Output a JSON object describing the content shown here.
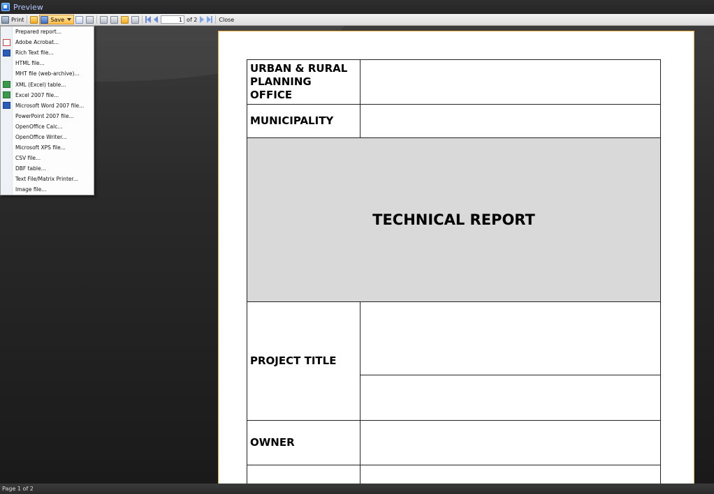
{
  "window": {
    "title": "Preview"
  },
  "toolbar": {
    "print_label": "Print",
    "save_label": "Save",
    "page_value": "1",
    "page_of": "of 2",
    "close_label": "Close"
  },
  "save_menu": {
    "items": [
      {
        "label": "Prepared report...",
        "icon": "none"
      },
      {
        "label": "Adobe Acrobat...",
        "icon": "pdf-icon"
      },
      {
        "label": "Rich Text file...",
        "icon": "word-icon"
      },
      {
        "label": "HTML file...",
        "icon": "none"
      },
      {
        "label": "MHT file (web-archive)...",
        "icon": "none"
      },
      {
        "label": "XML (Excel) table...",
        "icon": "excel-icon"
      },
      {
        "label": "Excel 2007 file...",
        "icon": "excel-icon"
      },
      {
        "label": "Microsoft Word 2007 file...",
        "icon": "word-icon"
      },
      {
        "label": "PowerPoint 2007 file...",
        "icon": "none"
      },
      {
        "label": "OpenOffice Calc...",
        "icon": "none"
      },
      {
        "label": "OpenOffice Writer...",
        "icon": "none"
      },
      {
        "label": "Microsoft XPS file...",
        "icon": "none"
      },
      {
        "label": "CSV file...",
        "icon": "none"
      },
      {
        "label": "DBF table...",
        "icon": "none"
      },
      {
        "label": "Text File/Matrix Printer...",
        "icon": "none"
      },
      {
        "label": "Image file...",
        "icon": "none"
      }
    ]
  },
  "document": {
    "office_label": "URBAN & RURAL PLANNING OFFICE",
    "municipality_label": "MUNICIPALITY",
    "report_title": "TECHNICAL REPORT",
    "project_title_label": "PROJECT TITLE",
    "owner_label": "OWNER"
  },
  "status": {
    "text": "Page 1 of 2"
  },
  "colors": {
    "page_border": "#e7a93b",
    "report_band": "#d9d9d9",
    "save_highlight": "#ffbf4a"
  }
}
